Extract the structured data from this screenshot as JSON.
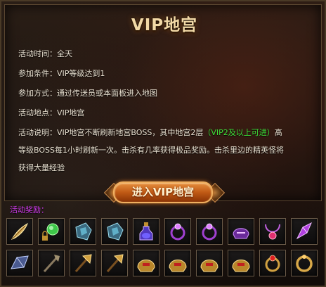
{
  "title": "VIP地宫",
  "info": {
    "time": "活动时间：全天",
    "condition": "参加条件：VIP等级达到1",
    "method": "参加方式：通过传送员或本面板进入地图",
    "location": "活动地点：VIP地宫",
    "desc_part1": "活动说明：VIP地宫不断刷新地宫BOSS，其中地宫2层",
    "desc_green": "（VIP2及以上可进）",
    "desc_part2": "高",
    "desc_line2": "等级BOSS每1小时刷新一次。击杀有几率获得极品奖励。击杀里边的精英怪将",
    "desc_line3": "获得大量经验"
  },
  "enter_button": "进入VIP地宫",
  "reward_label": "活动奖励：",
  "colors": {
    "accent_green": "#3fe23a",
    "reward_label": "#d23cf0",
    "title": "#f2d9a6"
  },
  "rewards": [
    {
      "icon": "golden-feather-icon"
    },
    {
      "icon": "green-orb-locked-icon"
    },
    {
      "icon": "blue-rune-stone-icon"
    },
    {
      "icon": "blue-rune-stone-icon"
    },
    {
      "icon": "potion-bottle-icon"
    },
    {
      "icon": "purple-gem-ring-icon"
    },
    {
      "icon": "purple-gem-ring-icon"
    },
    {
      "icon": "purple-helmet-icon"
    },
    {
      "icon": "purple-necklace-icon"
    },
    {
      "icon": "purple-crystal-icon"
    },
    {
      "icon": "blue-crystal-icon"
    },
    {
      "icon": "dark-staff-icon"
    },
    {
      "icon": "golden-axe-icon"
    },
    {
      "icon": "golden-axe-icon"
    },
    {
      "icon": "gold-red-helmet-icon"
    },
    {
      "icon": "gold-red-helmet-icon"
    },
    {
      "icon": "gold-red-helmet-icon"
    },
    {
      "icon": "gold-red-helmet-icon"
    },
    {
      "icon": "gold-red-ring-icon"
    },
    {
      "icon": "gold-ring-icon"
    }
  ]
}
